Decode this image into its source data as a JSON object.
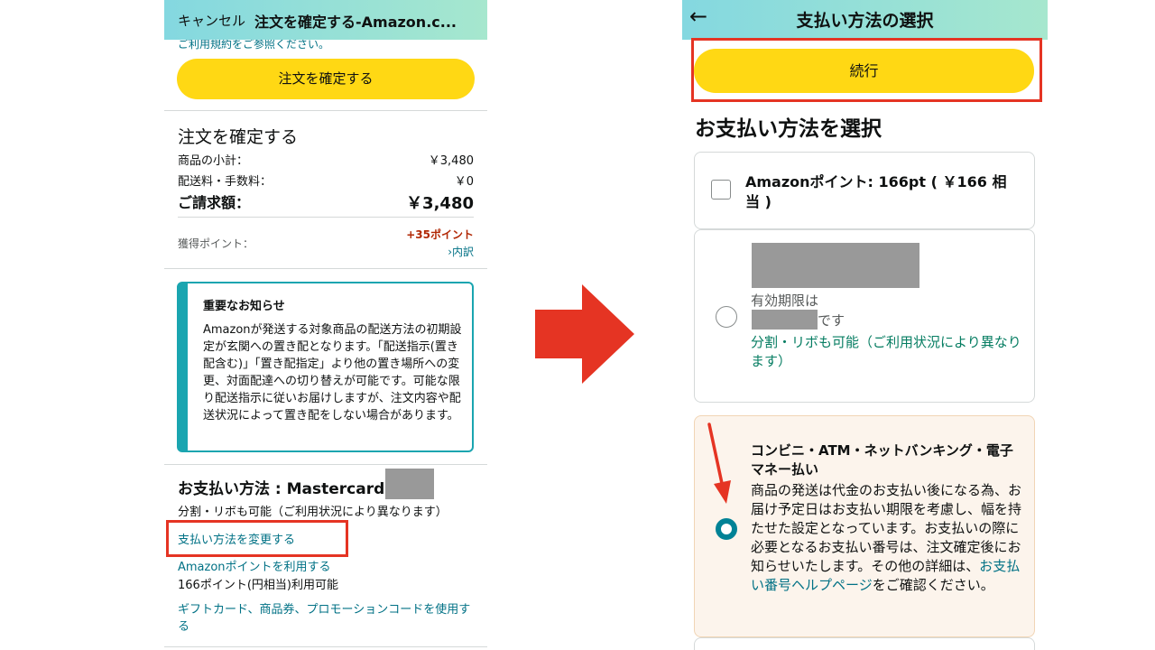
{
  "left": {
    "header": {
      "cancel": "キャンセル",
      "title": "注文を確定する-Amazon.c..."
    },
    "peek_text": "ご利用規約をご参照ください。",
    "confirm_button": "注文を確定する",
    "summary": {
      "title": "注文を確定する",
      "rows": [
        {
          "label": "商品の小計：",
          "value": "￥3,480"
        },
        {
          "label": "配送料・手数料：",
          "value": "￥0"
        }
      ],
      "total_label": "ご請求額：",
      "total_value": "￥3,480",
      "points_label": "獲得ポイント：",
      "points_value": "+35ポイント",
      "points_detail": "›内訳"
    },
    "notice": {
      "title": "重要なお知らせ",
      "body": "Amazonが発送する対象商品の配送方法の初期設定が玄関への置き配となります。「配送指示(置き配含む)」「置き配指定」より他の置き場所への変更、対面配達への切り替えが可能です。可能な限り配送指示に従いお届けしますが、注文内容や配送状況によって置き配をしない場合があります。"
    },
    "payment": {
      "title": "お支払い方法 : Mastercard",
      "subtitle": "分割・リボも可能（ご利用状況により異なります）",
      "change_link": "支払い方法を変更する",
      "amazon_points_link": "Amazonポイントを利用する",
      "amazon_points_note": "166ポイント(円相当)利用可能",
      "gift_link": "ギフトカード、商品券、プロモーションコードを使用する"
    }
  },
  "right": {
    "header": {
      "back_icon": "←",
      "title": "支払い方法の選択"
    },
    "continue_button": "続行",
    "heading": "お支払い方法を選択",
    "options": [
      {
        "text": "Amazonポイント: 166pt ( ￥166 相当 )",
        "selected": false
      },
      {
        "expiry_prefix": "有効期限は",
        "expiry_suffix": "です",
        "installment": "分割・リボも可能（ご利用状況により異なります）",
        "selected": false
      },
      {
        "title": "コンビニ・ATM・ネットバンキング・電子マネー払い",
        "body_before": "商品の発送は代金のお支払い後になる為、お届け予定日はお支払い期限を考慮し、幅を持たせた設定となっています。お支払いの際に必要となるお支払い番号は、注文確定後にお知らせいたします。その他の詳細は、",
        "link": "お支払い番号ヘルプページ",
        "body_after": "をご確認ください。",
        "selected": true
      }
    ]
  },
  "colors": {
    "header_start": "#84d8e0",
    "header_end": "#a6e7ce",
    "button_yellow": "#ffd814",
    "link": "#007185",
    "annotation_red": "#e53423",
    "teal": "#1aa5b0"
  }
}
